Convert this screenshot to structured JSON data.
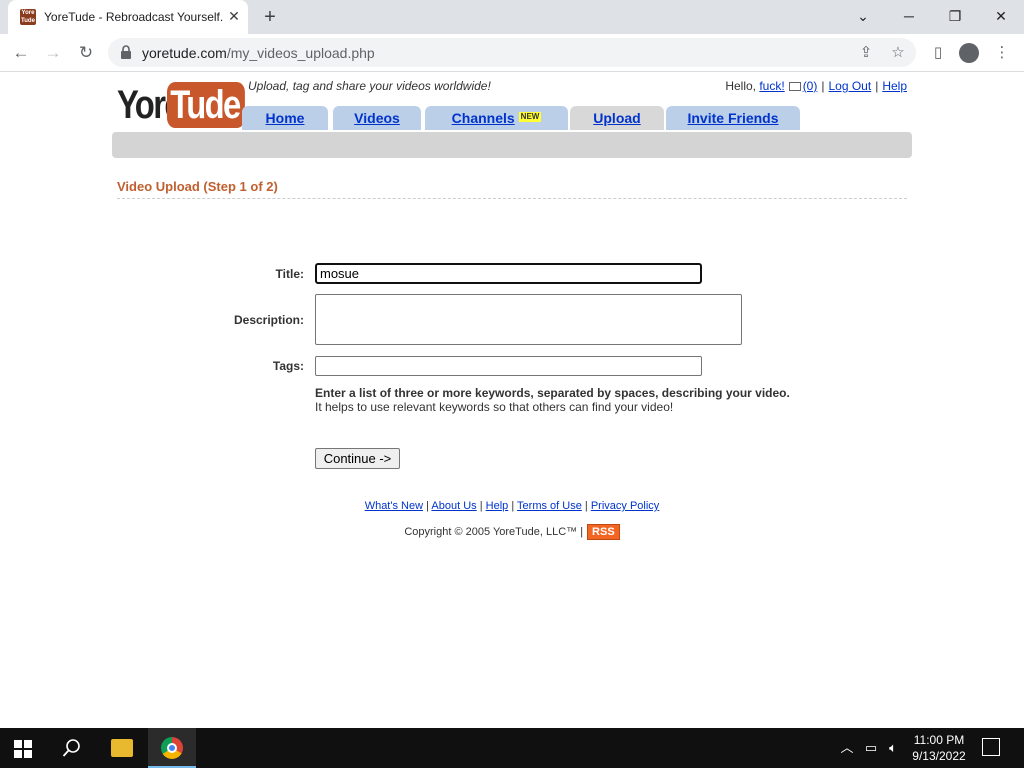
{
  "browser": {
    "tab_title": "YoreTude - Rebroadcast Yourself.",
    "favicon_text": "Yore Tude",
    "url_host": "yoretude.com",
    "url_path": "/my_videos_upload.php"
  },
  "site": {
    "logo_left": "Yore",
    "logo_right": "Tude",
    "tagline": "Upload, tag and share your videos worldwide!",
    "greeting": "Hello,",
    "username": "fuck!",
    "message_count": "(0)",
    "logout_label": "Log Out",
    "help_label": "Help",
    "nav": {
      "home": "Home",
      "videos": "Videos",
      "channels": "Channels",
      "channels_badge": "NEW",
      "upload": "Upload",
      "invite": "Invite Friends"
    }
  },
  "upload_form": {
    "heading": "Video Upload (Step 1 of 2)",
    "title_label": "Title:",
    "title_value": "mosue",
    "description_label": "Description:",
    "description_value": "",
    "tags_label": "Tags:",
    "tags_value": "",
    "tags_help_strong": "Enter a list of three or more keywords, separated by spaces, describing your video.",
    "tags_help_normal": "It helps to use relevant keywords so that others can find your video!",
    "continue_label": "Continue ->"
  },
  "footer": {
    "whats_new": "What's New",
    "about_us": "About Us",
    "help": "Help",
    "terms": "Terms of Use",
    "privacy": "Privacy Policy",
    "copyright": "Copyright © 2005 YoreTude, LLC™ |",
    "rss": "RSS"
  },
  "taskbar": {
    "time": "11:00 PM",
    "date": "9/13/2022"
  },
  "colors": {
    "brand_orange": "#c8572b",
    "nav_tab": "#bccfe9",
    "link_blue": "#0033cc"
  }
}
